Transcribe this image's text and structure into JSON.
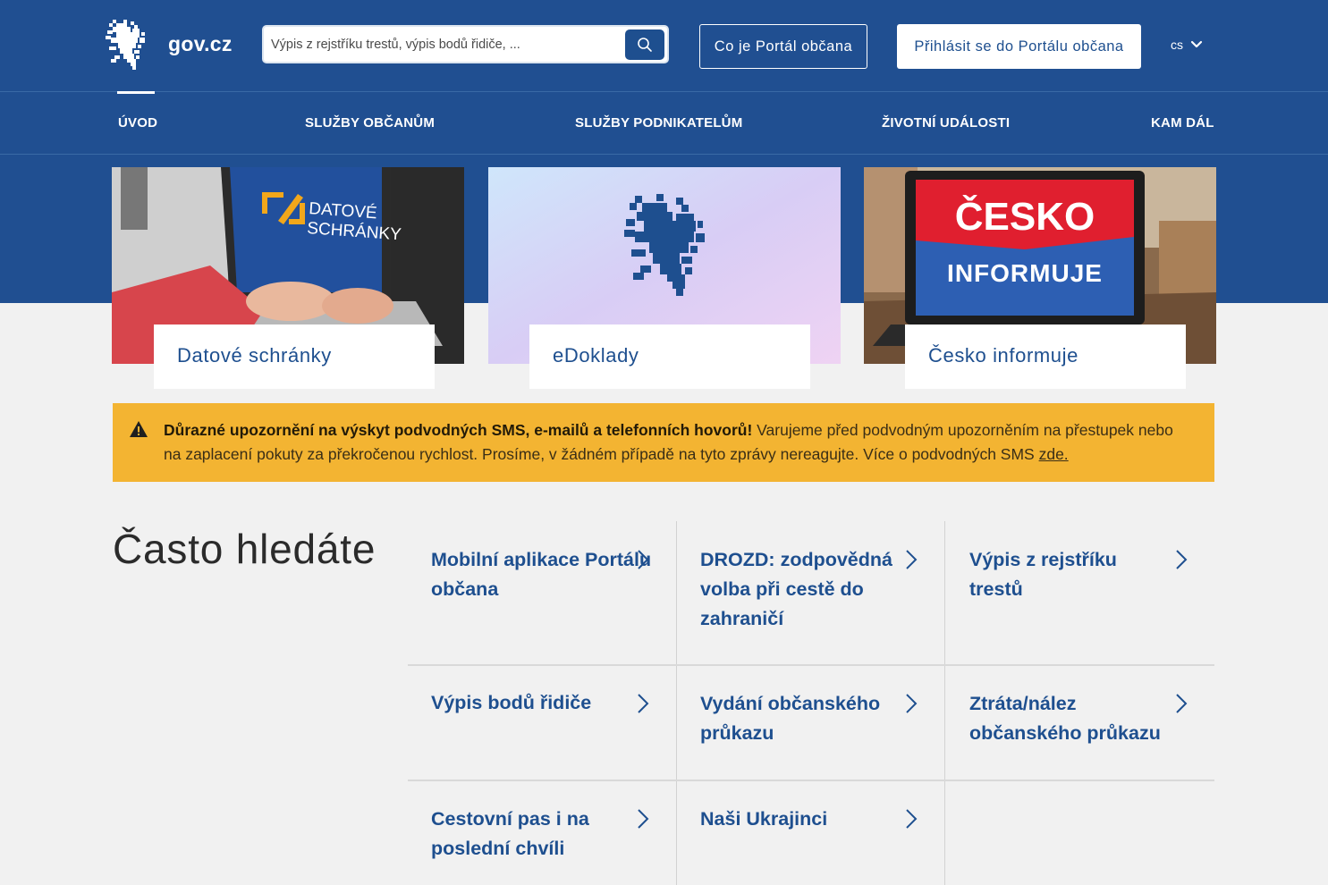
{
  "header": {
    "logo_text": "gov.cz",
    "search_placeholder": "Výpis z rejstříku trestů, výpis bodů řidiče, ...",
    "portal_info_button": "Co je Portál občana",
    "login_button": "Přihlásit se do Portálu občana",
    "language": "cs"
  },
  "nav": {
    "items": [
      "ÚVOD",
      "SLUŽBY OBČANŮM",
      "SLUŽBY PODNIKATELŮM",
      "ŽIVOTNÍ UDÁLOSTI",
      "KAM DÁL"
    ]
  },
  "cards": [
    {
      "label": "Datové schránky",
      "image_text_1": "DATOVÉ",
      "image_text_2": "SCHRÁNKY"
    },
    {
      "label": "eDoklady"
    },
    {
      "label": "Česko informuje",
      "image_text_1": "ČESKO",
      "image_text_2": "INFORMUJE"
    }
  ],
  "alert": {
    "bold": "Důrazné upozornění na výskyt podvodných SMS, e-mailů a telefonních hovorů!",
    "text": " Varujeme před podvodným upozorněním na přestupek nebo na zaplacení pokuty za překročenou rychlost. Prosíme, v žádném případě na tyto zprávy nereagujte. Více o podvodných SMS ",
    "link": "zde."
  },
  "often": {
    "title": "Často hledáte",
    "links": [
      "Mobilní aplikace Portálu občana",
      "DROZD: zodpovědná volba při cestě do zahraničí",
      "Výpis z rejstříku trestů",
      "Výpis bodů řidiče",
      "Vydání občanského průkazu",
      "Ztráta/nález občanského průkazu",
      "Cestovní pas i na poslední chvíli",
      "Naši Ukrajinci"
    ]
  },
  "colors": {
    "brand_blue": "#1e4f8f",
    "alert_yellow": "#f3b432",
    "background": "#f1f1f1"
  }
}
